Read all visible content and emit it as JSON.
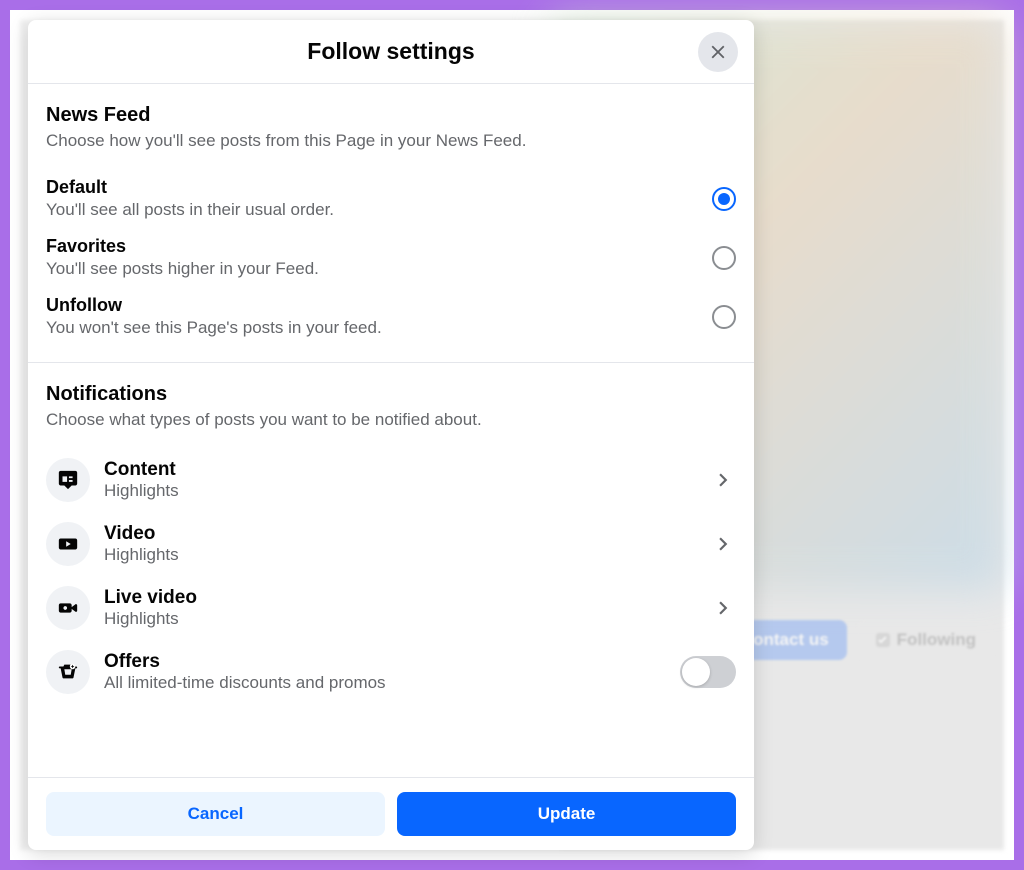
{
  "modal": {
    "title": "Follow settings",
    "sections": {
      "newsFeed": {
        "title": "News Feed",
        "desc": "Choose how you'll see posts from this Page in your News Feed.",
        "options": [
          {
            "label": "Default",
            "desc": "You'll see all posts in their usual order.",
            "selected": true
          },
          {
            "label": "Favorites",
            "desc": "You'll see posts higher in your Feed.",
            "selected": false
          },
          {
            "label": "Unfollow",
            "desc": "You won't see this Page's posts in your feed.",
            "selected": false
          }
        ]
      },
      "notifications": {
        "title": "Notifications",
        "desc": "Choose what types of posts you want to be notified about.",
        "items": [
          {
            "label": "Content",
            "value": "Highlights",
            "icon": "content",
            "type": "chevron"
          },
          {
            "label": "Video",
            "value": "Highlights",
            "icon": "video",
            "type": "chevron"
          },
          {
            "label": "Live video",
            "value": "Highlights",
            "icon": "live",
            "type": "chevron"
          },
          {
            "label": "Offers",
            "value": "All limited-time discounts and promos",
            "icon": "offers",
            "type": "toggle",
            "enabled": false
          }
        ]
      }
    },
    "footer": {
      "cancel": "Cancel",
      "update": "Update"
    }
  },
  "background": {
    "contactBtn": "Contact us",
    "followingBtn": "Following"
  }
}
